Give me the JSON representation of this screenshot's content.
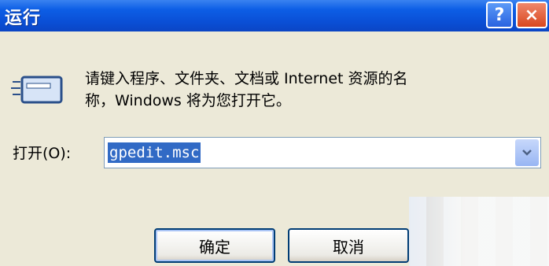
{
  "window": {
    "title": "运行",
    "help_label": "?",
    "close_label": "×"
  },
  "description": {
    "line1": "请键入程序、文件夹、文档或 Internet 资源的名",
    "line2": "称，Windows 将为您打开它。"
  },
  "open_field": {
    "label": "打开(O):",
    "value": "gpedit.msc"
  },
  "buttons": {
    "ok_label": "确定",
    "cancel_label": "取消"
  },
  "icons": {
    "run": "run-program-icon",
    "dropdown": "chevron-down-icon"
  },
  "colors": {
    "titlebar": "#0a4fd6",
    "selection": "#316ac5",
    "close_button": "#d8471f"
  }
}
